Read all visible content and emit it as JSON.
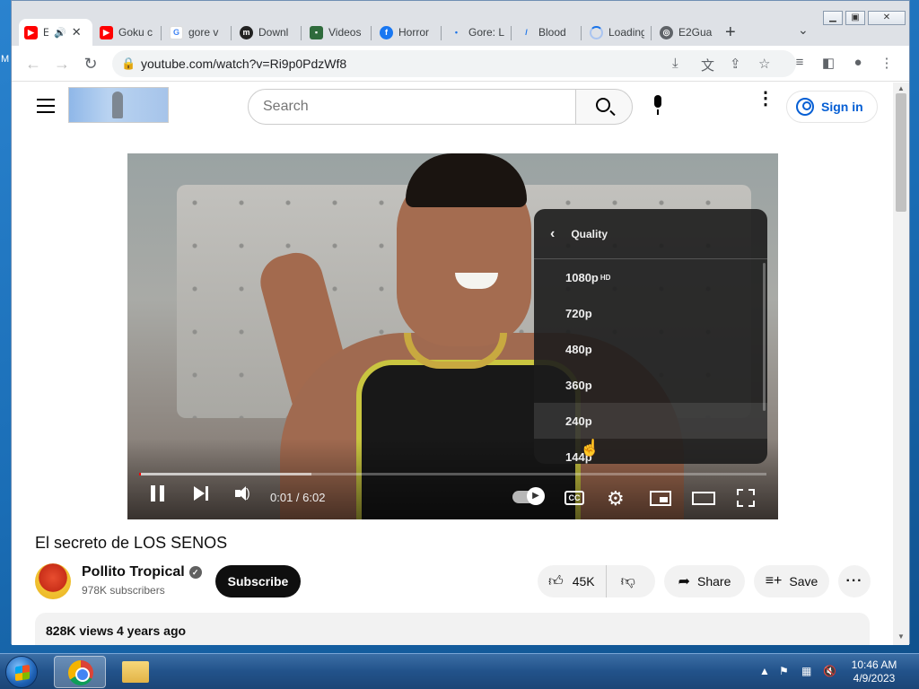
{
  "desktop": {
    "edge_letter": "M"
  },
  "browser": {
    "tabs": [
      {
        "title": "E",
        "favicon": "youtube-icon",
        "active": true,
        "audio_icon": "speaker-icon"
      },
      {
        "title": "Goku c",
        "favicon": "youtube-icon"
      },
      {
        "title": "gore v",
        "favicon": "google-icon"
      },
      {
        "title": "Downl",
        "favicon": "m-site-icon"
      },
      {
        "title": "Videos",
        "favicon": "video-site-icon"
      },
      {
        "title": "Horror",
        "favicon": "facebook-icon"
      },
      {
        "title": "Gore: L",
        "favicon": "dot-icon"
      },
      {
        "title": "Blood",
        "favicon": "slash-icon"
      },
      {
        "title": "Loading",
        "favicon": "spinner-icon"
      },
      {
        "title": "E2Gua",
        "favicon": "globe-icon"
      }
    ],
    "new_tab_label": "+",
    "url": "youtube.com/watch?v=Ri9p0PdzWf8"
  },
  "youtube": {
    "search_placeholder": "Search",
    "sign_in_label": "Sign in",
    "video": {
      "time": "0:01 / 6:02",
      "progress_played_fraction": 0.003,
      "progress_loaded_fraction": 0.275
    },
    "quality_menu": {
      "title": "Quality",
      "options": [
        {
          "label": "1080p",
          "badge": "HD"
        },
        {
          "label": "720p"
        },
        {
          "label": "480p"
        },
        {
          "label": "360p"
        },
        {
          "label": "240p",
          "hover": true
        },
        {
          "label": "144p"
        }
      ]
    },
    "title": "El secreto de LOS SENOS",
    "channel": {
      "name": "Pollito Tropical",
      "subscribers": "978K subscribers",
      "verified_icon": "checkmark-icon"
    },
    "subscribe_label": "Subscribe",
    "likes": "45K",
    "share_label": "Share",
    "save_label": "Save",
    "views": "828K views",
    "age": "4 years ago"
  },
  "taskbar": {
    "time": "10:46 AM",
    "date": "4/9/2023"
  }
}
